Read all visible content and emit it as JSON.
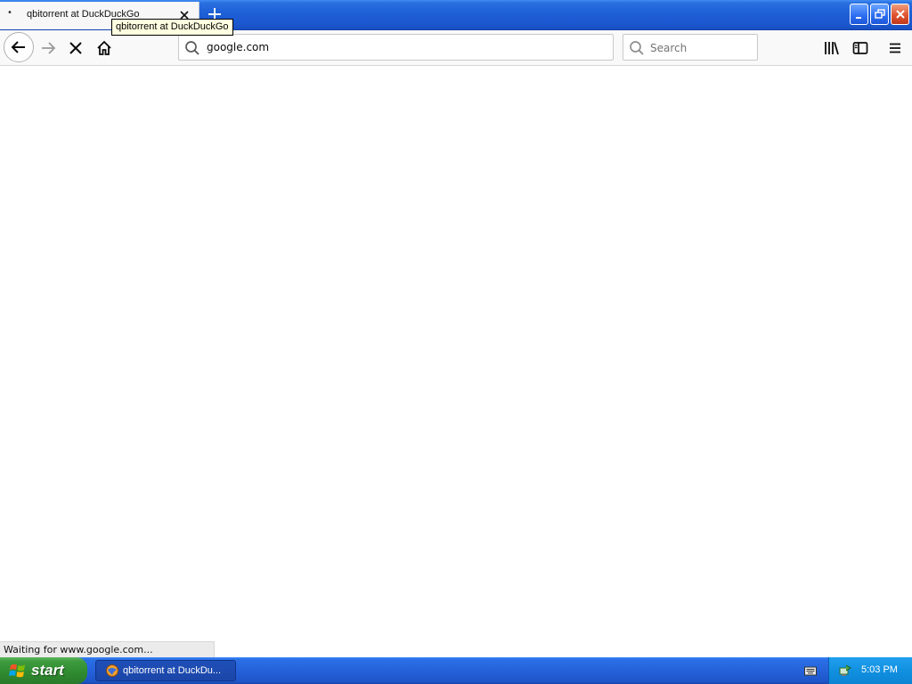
{
  "browser": {
    "tab": {
      "title": "qbitorrent at DuckDuckGo",
      "tooltip": "qbitorrent at DuckDuckGo",
      "loading_indicator": "•"
    },
    "url": "google.com",
    "search_placeholder": "Search",
    "status_text": "Waiting for www.google.com...",
    "icons": {
      "tab_close": "close-icon",
      "new_tab": "plus-icon",
      "back": "arrow-left-icon",
      "forward": "arrow-right-icon",
      "stop": "stop-x-icon",
      "home": "home-icon",
      "url": "search-icon",
      "search": "search-icon",
      "library": "library-icon",
      "sidebar": "sidebar-icon",
      "menu": "hamburger-menu-icon"
    }
  },
  "window_controls": {
    "minimize": "minimize-icon",
    "restore": "restore-icon",
    "close": "close-icon"
  },
  "taskbar": {
    "start_label": "start",
    "task_label": "qbitorrent at DuckDu...",
    "clock": "5:03 PM",
    "colors": {
      "taskbar_blue": "#2562da",
      "start_green": "#3d9b3d",
      "tray_blue": "#1290e0"
    }
  }
}
